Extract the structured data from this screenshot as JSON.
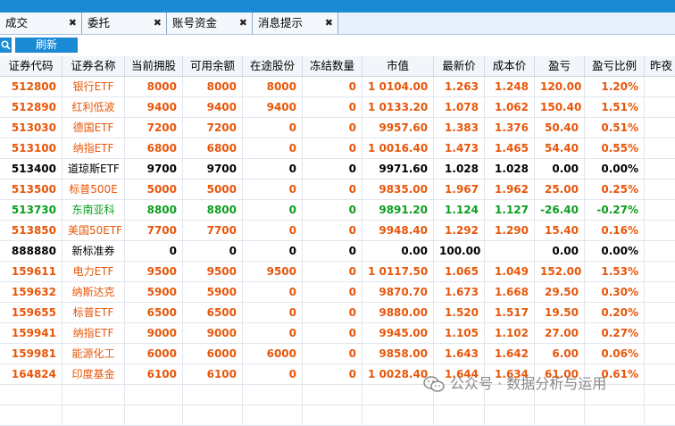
{
  "tabs": [
    {
      "label": "成交",
      "close": "✖"
    },
    {
      "label": "委托",
      "close": "✖"
    },
    {
      "label": "账号资金",
      "close": "✖"
    },
    {
      "label": "消息提示",
      "close": "✖"
    }
  ],
  "toolbar": {
    "refresh_label": "刷新"
  },
  "colors": {
    "up": "#e8560a",
    "down": "#0b9e1e",
    "flat": "#000000",
    "accent": "#1a8ad4"
  },
  "table": {
    "headers": [
      "证券代码",
      "证券名称",
      "当前拥股",
      "可用余额",
      "在途股份",
      "冻结数量",
      "市值",
      "最新价",
      "成本价",
      "盈亏",
      "盈亏比例",
      "昨夜"
    ],
    "rows": [
      {
        "code": "512800",
        "name": "银行ETF",
        "hold": "8000",
        "avail": "8000",
        "transit": "8000",
        "frozen": "0",
        "mv": "1 0104.00",
        "last": "1.263",
        "cost": "1.248",
        "pnl": "120.00",
        "pct": "1.20%",
        "color": "red"
      },
      {
        "code": "512890",
        "name": "红利低波",
        "hold": "9400",
        "avail": "9400",
        "transit": "9400",
        "frozen": "0",
        "mv": "1 0133.20",
        "last": "1.078",
        "cost": "1.062",
        "pnl": "150.40",
        "pct": "1.51%",
        "color": "red"
      },
      {
        "code": "513030",
        "name": "德国ETF",
        "hold": "7200",
        "avail": "7200",
        "transit": "0",
        "frozen": "0",
        "mv": "9957.60",
        "last": "1.383",
        "cost": "1.376",
        "pnl": "50.40",
        "pct": "0.51%",
        "color": "red"
      },
      {
        "code": "513100",
        "name": "纳指ETF",
        "hold": "6800",
        "avail": "6800",
        "transit": "0",
        "frozen": "0",
        "mv": "1 0016.40",
        "last": "1.473",
        "cost": "1.465",
        "pnl": "54.40",
        "pct": "0.55%",
        "color": "red"
      },
      {
        "code": "513400",
        "name": "道琼斯ETF",
        "hold": "9700",
        "avail": "9700",
        "transit": "0",
        "frozen": "0",
        "mv": "9971.60",
        "last": "1.028",
        "cost": "1.028",
        "pnl": "0.00",
        "pct": "0.00%",
        "color": "black"
      },
      {
        "code": "513500",
        "name": "标普500E",
        "hold": "5000",
        "avail": "5000",
        "transit": "0",
        "frozen": "0",
        "mv": "9835.00",
        "last": "1.967",
        "cost": "1.962",
        "pnl": "25.00",
        "pct": "0.25%",
        "color": "red"
      },
      {
        "code": "513730",
        "name": "东南亚科",
        "hold": "8800",
        "avail": "8800",
        "transit": "0",
        "frozen": "0",
        "mv": "9891.20",
        "last": "1.124",
        "cost": "1.127",
        "pnl": "-26.40",
        "pct": "-0.27%",
        "color": "green"
      },
      {
        "code": "513850",
        "name": "美国50ETF",
        "hold": "7700",
        "avail": "7700",
        "transit": "0",
        "frozen": "0",
        "mv": "9948.40",
        "last": "1.292",
        "cost": "1.290",
        "pnl": "15.40",
        "pct": "0.16%",
        "color": "red"
      },
      {
        "code": "888880",
        "name": "新标准券",
        "hold": "0",
        "avail": "0",
        "transit": "0",
        "frozen": "0",
        "mv": "0.00",
        "last": "100.00",
        "cost": "",
        "pnl": "0.00",
        "pct": "0.00%",
        "color": "black"
      },
      {
        "code": "159611",
        "name": "电力ETF",
        "hold": "9500",
        "avail": "9500",
        "transit": "9500",
        "frozen": "0",
        "mv": "1 0117.50",
        "last": "1.065",
        "cost": "1.049",
        "pnl": "152.00",
        "pct": "1.53%",
        "color": "red"
      },
      {
        "code": "159632",
        "name": "纳斯达克",
        "hold": "5900",
        "avail": "5900",
        "transit": "0",
        "frozen": "0",
        "mv": "9870.70",
        "last": "1.673",
        "cost": "1.668",
        "pnl": "29.50",
        "pct": "0.30%",
        "color": "red"
      },
      {
        "code": "159655",
        "name": "标普ETF",
        "hold": "6500",
        "avail": "6500",
        "transit": "0",
        "frozen": "0",
        "mv": "9880.00",
        "last": "1.520",
        "cost": "1.517",
        "pnl": "19.50",
        "pct": "0.20%",
        "color": "red"
      },
      {
        "code": "159941",
        "name": "纳指ETF",
        "hold": "9000",
        "avail": "9000",
        "transit": "0",
        "frozen": "0",
        "mv": "9945.00",
        "last": "1.105",
        "cost": "1.102",
        "pnl": "27.00",
        "pct": "0.27%",
        "color": "red"
      },
      {
        "code": "159981",
        "name": "能源化工",
        "hold": "6000",
        "avail": "6000",
        "transit": "6000",
        "frozen": "0",
        "mv": "9858.00",
        "last": "1.643",
        "cost": "1.642",
        "pnl": "6.00",
        "pct": "0.06%",
        "color": "red"
      },
      {
        "code": "164824",
        "name": "印度基金",
        "hold": "6100",
        "avail": "6100",
        "transit": "0",
        "frozen": "0",
        "mv": "1 0028.40",
        "last": "1.644",
        "cost": "1.634",
        "pnl": "61.00",
        "pct": "0.61%",
        "color": "red"
      }
    ]
  },
  "watermark": {
    "text": "公众号 · 数据分析与运用"
  }
}
